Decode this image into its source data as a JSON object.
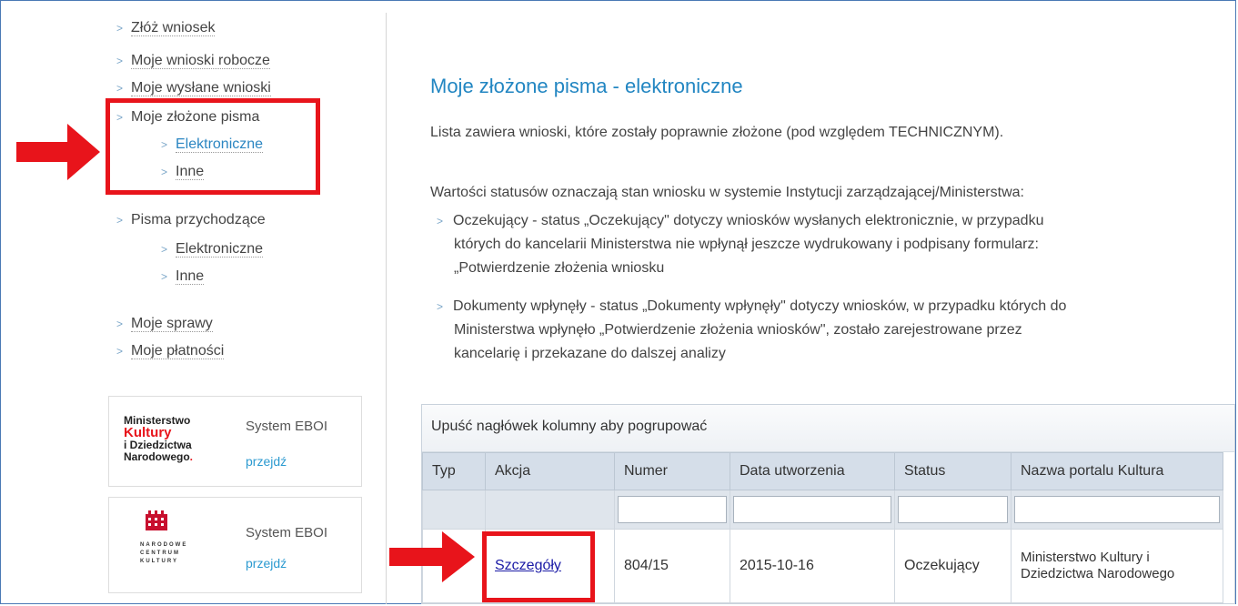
{
  "nav": {
    "items": [
      {
        "label": "Złóż wniosek"
      },
      {
        "label": "Moje wnioski robocze"
      },
      {
        "label": "Moje wysłane wnioski"
      },
      {
        "label": "Moje złożone pisma"
      },
      {
        "label": "Elektroniczne"
      },
      {
        "label": "Inne"
      },
      {
        "label": "Pisma przychodzące"
      },
      {
        "label": "Elektroniczne"
      },
      {
        "label": "Inne"
      },
      {
        "label": "Moje sprawy"
      },
      {
        "label": "Moje płatności"
      }
    ]
  },
  "logos": [
    {
      "name_lines": [
        "Ministerstwo",
        "Kultury",
        "i Dziedzictwa",
        "Narodowego"
      ],
      "system": "System EBOI",
      "go": "przejdź"
    },
    {
      "name_lines": [
        "NARODOWE",
        "CENTRUM",
        "KULTURY"
      ],
      "system": "System EBOI",
      "go": "przejdź"
    }
  ],
  "page": {
    "title": "Moje złożone pisma - elektroniczne",
    "intro": "Lista zawiera wnioski, które zostały poprawnie złożone (pod względem TECHNICZNYM).",
    "status_intro": "Wartości statusów oznaczają stan wniosku w systemie Instytucji zarządzającej/Ministerstwa:",
    "bullet1_l1": "Oczekujący - status „Oczekujący\" dotyczy wniosków wysłanych elektronicznie, w przypadku",
    "bullet1_l2": "których do kancelarii Ministerstwa nie wpłynął jeszcze wydrukowany i podpisany formularz:",
    "bullet1_l3": "„Potwierdzenie złożenia wniosku",
    "bullet2_l1": "Dokumenty wpłynęły - status „Dokumenty wpłynęły\" dotyczy wniosków, w przypadku których do",
    "bullet2_l2": "Ministerstwa wpłynęło „Potwierdzenie złożenia wniosków\", zostało zarejestrowane przez",
    "bullet2_l3": "kancelarię i przekazane do dalszej analizy"
  },
  "grid": {
    "group_hint": "Upuść nagłówek kolumny aby pogrupować",
    "columns": [
      "Typ",
      "Akcja",
      "Numer",
      "Data utworzenia",
      "Status",
      "Nazwa portalu Kultura"
    ],
    "rows": [
      {
        "typ": "",
        "akcja": "Szczegóły",
        "numer": "804/15",
        "data": "2015-10-16",
        "status": "Oczekujący",
        "portal": "Ministerstwo Kultury i Dziedzictwa Narodowego"
      }
    ]
  },
  "colors": {
    "accent": "#2286c2",
    "highlight": "#e8141b"
  }
}
